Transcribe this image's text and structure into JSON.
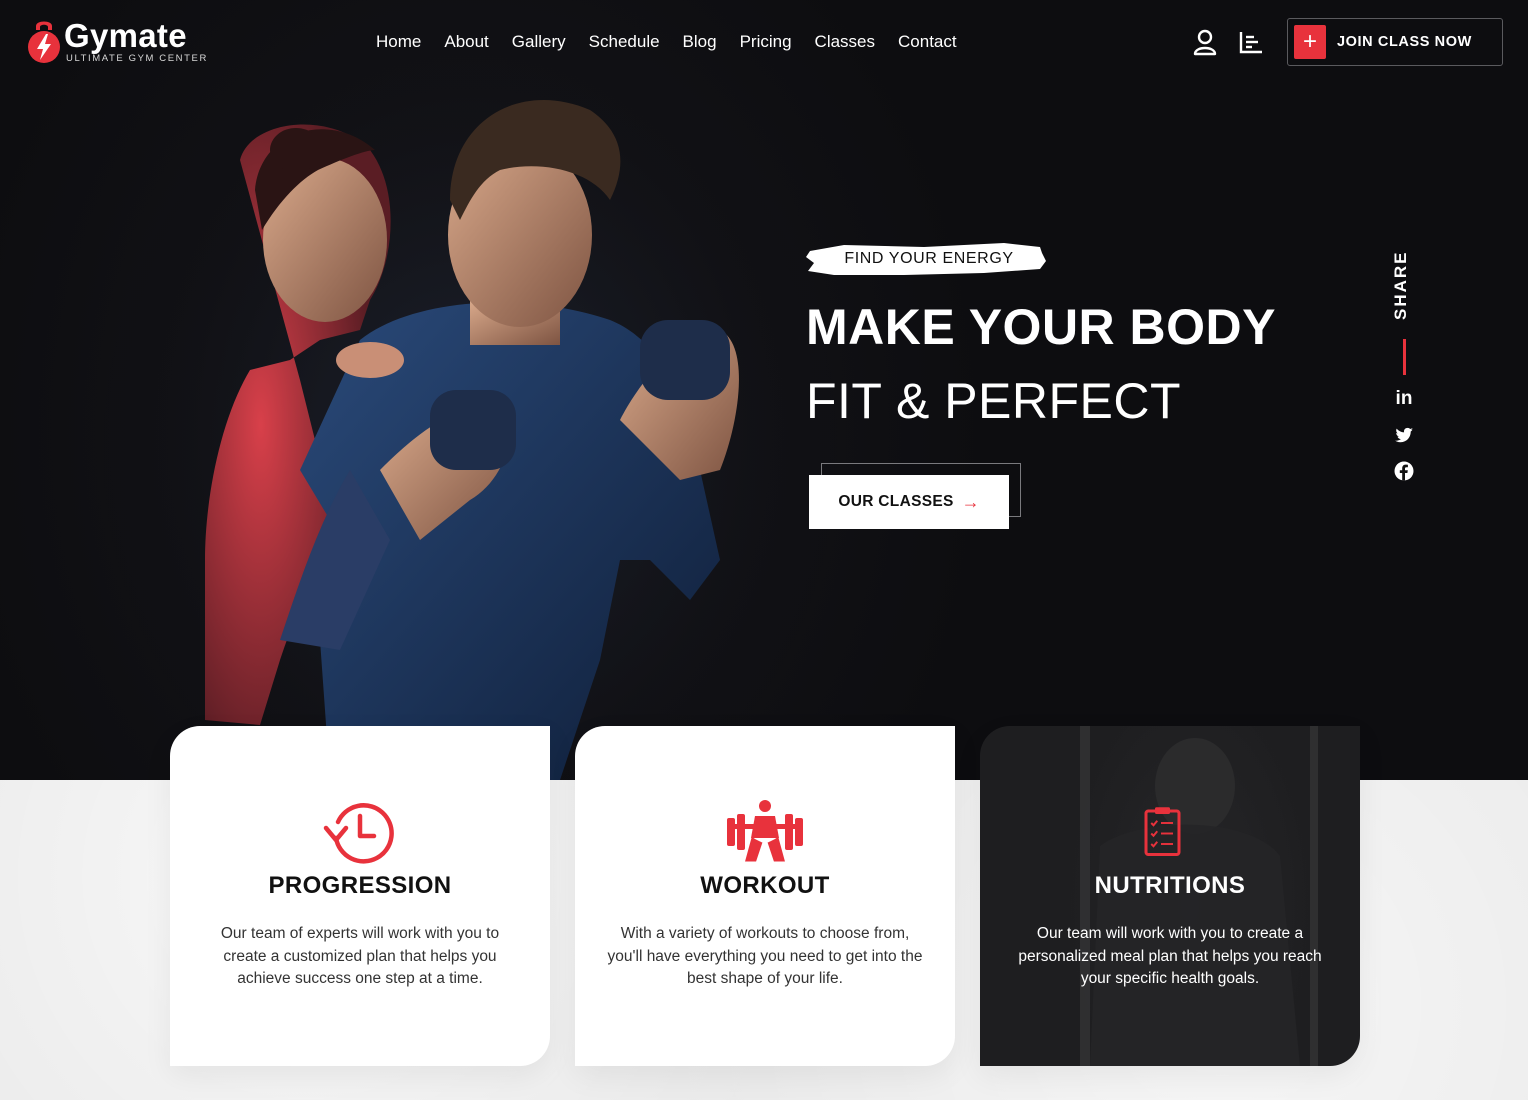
{
  "brand": {
    "name": "Gymate",
    "tagline": "ULTIMATE GYM CENTER",
    "accent_color": "#e8323c"
  },
  "nav": {
    "items": [
      "Home",
      "About",
      "Gallery",
      "Schedule",
      "Blog",
      "Pricing",
      "Classes",
      "Contact"
    ]
  },
  "header": {
    "user_icon": "user-icon",
    "menu_icon": "chart-menu-icon",
    "join_button": {
      "icon": "plus-icon",
      "label": "JOIN CLASS NOW"
    }
  },
  "hero": {
    "tagline": "FIND YOUR ENERGY",
    "headline_1": "MAKE YOUR BODY",
    "headline_2": "FIT & PERFECT",
    "cta": {
      "label": "OUR CLASSES",
      "icon": "arrow-right-icon"
    },
    "share": {
      "label": "SHARE",
      "icons": [
        "linkedin-icon",
        "twitter-icon",
        "facebook-icon"
      ]
    }
  },
  "features": [
    {
      "icon": "clock-history-icon",
      "title": "PROGRESSION",
      "text": "Our team of experts will work with you to create a customized plan that helps you achieve success one step at a time."
    },
    {
      "icon": "weightlifter-icon",
      "title": "WORKOUT",
      "text": "With a variety of workouts to choose from, you'll have everything you need to get into the best shape of your life."
    },
    {
      "icon": "clipboard-checklist-icon",
      "title": "NUTRITIONS",
      "text": "Our team will work with you to create a personalized meal plan that helps you reach your specific health goals."
    }
  ]
}
